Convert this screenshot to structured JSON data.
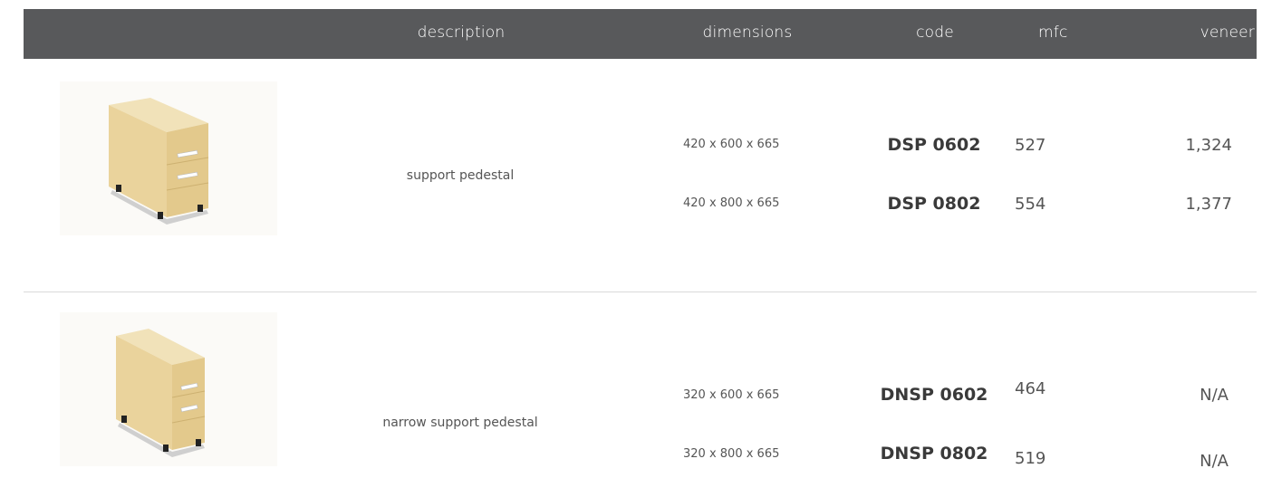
{
  "header": {
    "description": "description",
    "dimensions": "dimensions",
    "code": "code",
    "mfc": "mfc",
    "veneer": "veneer"
  },
  "colors": {
    "header_bg": "#58595b",
    "header_text": "#ffffff",
    "wood": "#ecd9a7",
    "divider": "#d9d9d9"
  },
  "products": [
    {
      "image_icon": "pedestal-image",
      "description": "support pedestal",
      "variants": [
        {
          "dimensions": "420 x 600 x 665",
          "code": "DSP 0602",
          "mfc": "527",
          "veneer": "1,324"
        },
        {
          "dimensions": "420 x 800 x 665",
          "code": "DSP 0802",
          "mfc": "554",
          "veneer": "1,377"
        }
      ]
    },
    {
      "image_icon": "narrow-pedestal-image",
      "description": "narrow support pedestal",
      "variants": [
        {
          "dimensions": "320 x 600 x 665",
          "code": "DNSP 0602",
          "mfc": "464",
          "veneer": "N/A"
        },
        {
          "dimensions": "320 x 800 x 665",
          "code": "DNSP 0802",
          "mfc": "519",
          "veneer": "N/A"
        }
      ]
    }
  ]
}
